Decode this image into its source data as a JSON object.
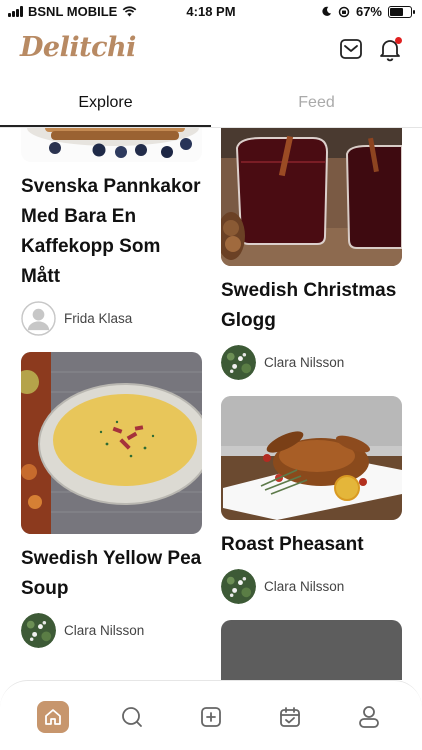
{
  "status_bar": {
    "carrier": "BSNL MOBILE",
    "time": "4:18 PM",
    "battery": "67%",
    "battery_level": 0.67
  },
  "header": {
    "app_title": "Delitchi",
    "icons": [
      "mail-icon",
      "bell-icon"
    ]
  },
  "tabs": [
    {
      "label": "Explore",
      "active": true
    },
    {
      "label": "Feed",
      "active": false
    }
  ],
  "recipes": [
    {
      "title": "Svenska Pannkakor Med Bara En Kaffekopp Som Mått",
      "author": "Frida Klasa",
      "image": "pancakes-photo",
      "avatar": "default-avatar-icon"
    },
    {
      "title": "Swedish Christmas Glogg",
      "author": "Clara Nilsson",
      "image": "glogg-photo",
      "avatar": "flower-avatar"
    },
    {
      "title": "Swedish Yellow Pea Soup",
      "author": "Clara Nilsson",
      "image": "pea-soup-photo",
      "avatar": "flower-avatar"
    },
    {
      "title": "Roast Pheasant",
      "author": "Clara Nilsson",
      "image": "pheasant-photo",
      "avatar": "flower-avatar"
    }
  ],
  "bottom_nav": [
    {
      "icon": "home-icon",
      "active": true
    },
    {
      "icon": "search-icon",
      "active": false
    },
    {
      "icon": "add-icon",
      "active": false
    },
    {
      "icon": "calendar-icon",
      "active": false
    },
    {
      "icon": "profile-icon",
      "active": false
    }
  ],
  "colors": {
    "brand": "#b88a63",
    "nav_active": "#c7966d",
    "notification_dot": "#e02020"
  }
}
